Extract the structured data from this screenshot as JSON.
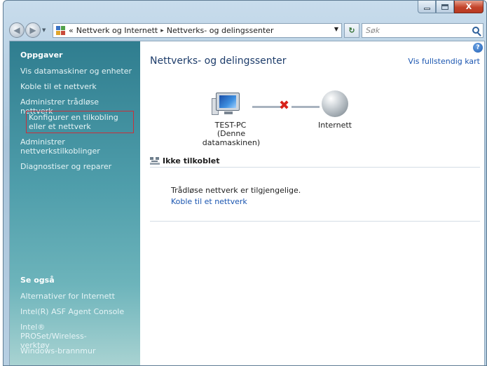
{
  "window": {
    "caption_buttons": {
      "minimize": "–",
      "maximize": "□",
      "close": "X"
    }
  },
  "toolbar": {
    "breadcrumb_prefix": "«",
    "breadcrumb": [
      "Nettverk og Internett",
      "Nettverks- og delingssenter"
    ],
    "breadcrumb_separator": "▸",
    "search_placeholder": "Søk"
  },
  "sidebar": {
    "tasks_heading": "Oppgaver",
    "tasks": [
      "Vis datamaskiner og enheter",
      "Koble til et nettverk",
      "Administrer trådløse nettverk",
      "Konfigurer en tilkobling eller et nettverk",
      "Administrer nettverkstilkoblinger",
      "Diagnostiser og reparer"
    ],
    "see_also_heading": "Se også",
    "see_also": [
      "Alternativer for Internett",
      "Intel(R) ASF Agent Console",
      "Intel® PROSet/Wireless-verktøy",
      "Windows-brannmur"
    ],
    "highlight_color": "#c8303b"
  },
  "main": {
    "title": "Nettverks- og delingssenter",
    "full_map_link": "Vis fullstendig kart",
    "computer_name": "TEST-PC",
    "computer_subtitle": "(Denne datamaskinen)",
    "internet_label": "Internett",
    "status_heading": "Ikke tilkoblet",
    "wireless_available": "Trådløse nettverk er tilgjengelige.",
    "connect_link": "Koble til et nettverk",
    "disconnected_mark_color": "#d8221a",
    "link_color": "#1a55b0"
  }
}
